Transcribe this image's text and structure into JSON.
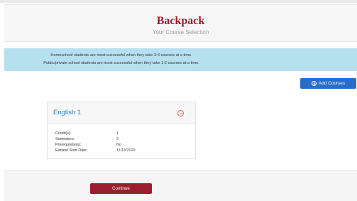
{
  "header": {
    "title": "Backpack",
    "subtitle": "Your Course Selection"
  },
  "notice": {
    "line1": "Homeschool students are most successful when they take 3-4 courses at a time.",
    "line2": "Public/private school students are most successful when they take 1-2 courses at a time."
  },
  "add_button": {
    "label": "Add Courses",
    "icon": "plus-circle-icon"
  },
  "course": {
    "title": "English 1",
    "remove_icon": "minus-circle-icon",
    "details": [
      {
        "label": "Credit(s):",
        "value": "1"
      },
      {
        "label": "Semesters:",
        "value": "2"
      },
      {
        "label": "Prerequisite(s):",
        "value": "No"
      },
      {
        "label": "Earliest Start Date:",
        "value": "11/13/2020"
      }
    ]
  },
  "continue_button": {
    "label": "Continue"
  },
  "colors": {
    "brand": "#9a1f2e",
    "primary_button": "#2a6cc9",
    "notice_bg": "#b7e0ef",
    "course_title": "#2e7fc1",
    "remove": "#e15a5a"
  }
}
